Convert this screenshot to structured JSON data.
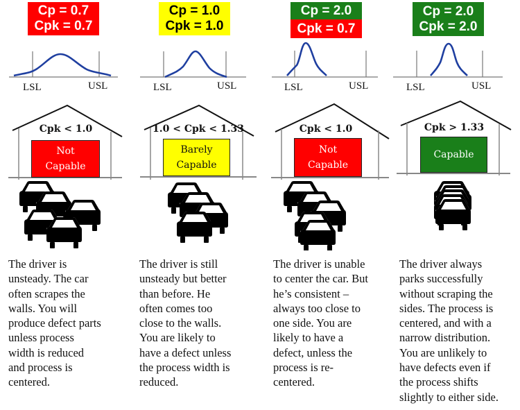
{
  "colors": {
    "red": "#ff0000",
    "yellow": "#ffff00",
    "green": "#1a7f1a",
    "curve": "#1f3fa0"
  },
  "scenarios": [
    {
      "cp_label": "Cp = 0.7",
      "cpk_label": "Cpk = 0.7",
      "cp_color": "#ff0000",
      "cpk_color": "#ff0000",
      "text_color": "#ffffff",
      "lsl": "LSL",
      "usl": "USL",
      "condition": "Cpk < 1.0",
      "verdict_line1": "Not",
      "verdict_line2": "Capable",
      "verdict_color": "#ff0000",
      "verdict_text_color": "#ffffff",
      "description": "The driver is unsteady. The car often scrapes the walls. You will produce defect parts unless process width is reduced and process is centered.",
      "description_lines": [
        "The driver is",
        "unsteady. The car",
        "often scrapes the",
        "walls. You will",
        "produce defect parts",
        "unless process",
        "width is reduced",
        "and process is",
        "centered."
      ]
    },
    {
      "cp_label": "Cp = 1.0",
      "cpk_label": "Cpk = 1.0",
      "cp_color": "#ffff00",
      "cpk_color": "#ffff00",
      "text_color": "#000000",
      "lsl": "LSL",
      "usl": "USL",
      "condition": "1.0 < Cpk < 1.33",
      "verdict_line1": "Barely",
      "verdict_line2": "Capable",
      "verdict_color": "#ffff00",
      "verdict_text_color": "#111111",
      "description": "The driver is still unsteady but better than before. He often comes too close to the walls. You are likely to have a defect unless the process width is reduced.",
      "description_lines": [
        "The driver is still",
        "unsteady but better",
        "than before. He",
        "often comes too",
        "close to the walls.",
        "You are likely to",
        "have a defect unless",
        "the process width is",
        "reduced."
      ]
    },
    {
      "cp_label": "Cp = 2.0",
      "cpk_label": "Cpk = 0.7",
      "cp_color": "#1a7f1a",
      "cpk_color": "#ff0000",
      "text_color": "#ffffff",
      "lsl": "LSL",
      "usl": "USL",
      "condition": "Cpk < 1.0",
      "verdict_line1": "Not",
      "verdict_line2": "Capable",
      "verdict_color": "#ff0000",
      "verdict_text_color": "#ffffff",
      "description": "The driver is unable to center the car. But he’s consistent – always too close to one side. You are likely to have a defect, unless the process is re-centered.",
      "description_lines": [
        "The driver is unable",
        "to center the car. But",
        "he’s consistent –",
        "always too close to",
        "one side. You are",
        "likely to have a",
        "defect, unless the",
        "process is re-",
        "centered."
      ]
    },
    {
      "cp_label": "Cp = 2.0",
      "cpk_label": "Cpk = 2.0",
      "cp_color": "#1a7f1a",
      "cpk_color": "#1a7f1a",
      "text_color": "#ffffff",
      "lsl": "LSL",
      "usl": "USL",
      "condition": "Cpk > 1.33",
      "verdict_line1": "Capable",
      "verdict_line2": "",
      "verdict_color": "#1a7f1a",
      "verdict_text_color": "#ffffff",
      "description": "The driver always parks successfully without scraping the sides. The process is centered, and with a narrow distribution. You are unlikely to have defects even if the process shifts slightly to either side.",
      "description_lines": [
        "The driver always",
        "parks successfully",
        "without scraping the",
        "sides. The process is",
        "centered, and with a",
        "narrow distribution.",
        "You are unlikely to",
        "have defects even if",
        "the process shifts",
        "slightly to either side."
      ]
    }
  ]
}
